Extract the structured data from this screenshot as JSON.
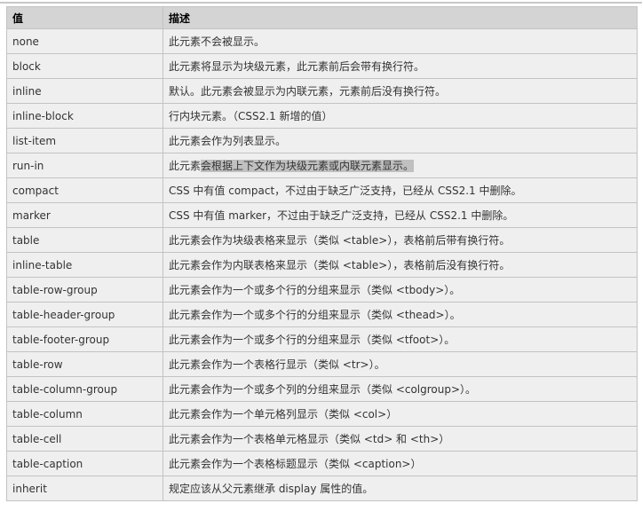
{
  "header": {
    "value": "值",
    "description": "描述"
  },
  "rows": [
    {
      "value": "none",
      "description": "此元素不会被显示。"
    },
    {
      "value": "block",
      "description": "此元素将显示为块级元素，此元素前后会带有换行符。"
    },
    {
      "value": "inline",
      "description": "默认。此元素会被显示为内联元素，元素前后没有换行符。"
    },
    {
      "value": "inline-block",
      "description": "行内块元素。（CSS2.1 新增的值）"
    },
    {
      "value": "list-item",
      "description": "此元素会作为列表显示。"
    },
    {
      "value": "run-in",
      "description": "此元素",
      "highlighted": "会根据上下文作为块级元素或内联元素显示。"
    },
    {
      "value": "compact",
      "description": "CSS 中有值 compact，不过由于缺乏广泛支持，已经从 CSS2.1 中删除。"
    },
    {
      "value": "marker",
      "description": "CSS 中有值 marker，不过由于缺乏广泛支持，已经从 CSS2.1 中删除。"
    },
    {
      "value": "table",
      "description": "此元素会作为块级表格来显示（类似 <table>），表格前后带有换行符。"
    },
    {
      "value": "inline-table",
      "description": "此元素会作为内联表格来显示（类似 <table>），表格前后没有换行符。"
    },
    {
      "value": "table-row-group",
      "description": "此元素会作为一个或多个行的分组来显示（类似 <tbody>）。"
    },
    {
      "value": "table-header-group",
      "description": "此元素会作为一个或多个行的分组来显示（类似 <thead>）。"
    },
    {
      "value": "table-footer-group",
      "description": "此元素会作为一个或多个行的分组来显示（类似 <tfoot>）。"
    },
    {
      "value": "table-row",
      "description": "此元素会作为一个表格行显示（类似 <tr>）。"
    },
    {
      "value": "table-column-group",
      "description": "此元素会作为一个或多个列的分组来显示（类似 <colgroup>）。"
    },
    {
      "value": "table-column",
      "description": "此元素会作为一个单元格列显示（类似 <col>）"
    },
    {
      "value": "table-cell",
      "description": "此元素会作为一个表格单元格显示（类似 <td> 和 <th>）"
    },
    {
      "value": "table-caption",
      "description": "此元素会作为一个表格标题显示（类似 <caption>）"
    },
    {
      "value": "inherit",
      "description": "规定应该从父元素继承 display 属性的值。"
    }
  ]
}
